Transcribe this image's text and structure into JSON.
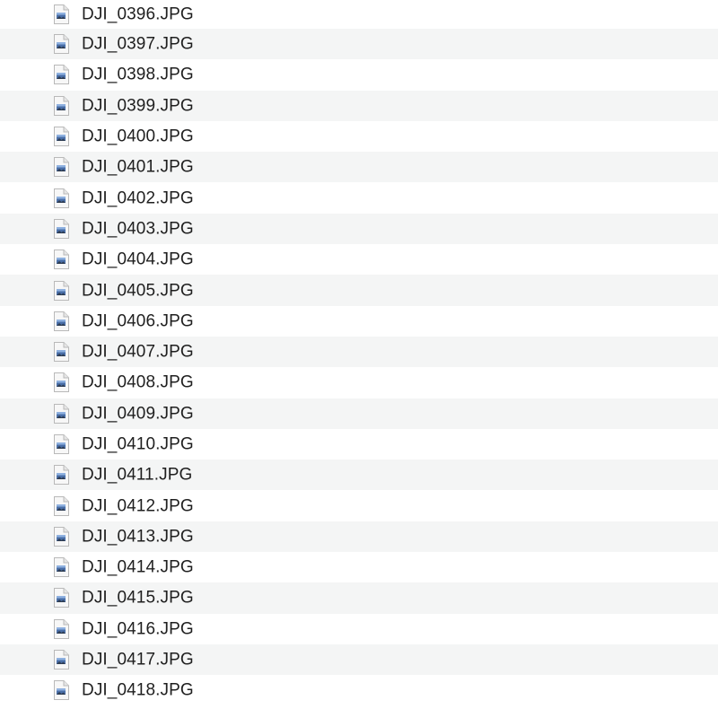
{
  "file_list": {
    "icon": "jpeg-image-file-icon",
    "files": [
      "DJI_0396.JPG",
      "DJI_0397.JPG",
      "DJI_0398.JPG",
      "DJI_0399.JPG",
      "DJI_0400.JPG",
      "DJI_0401.JPG",
      "DJI_0402.JPG",
      "DJI_0403.JPG",
      "DJI_0404.JPG",
      "DJI_0405.JPG",
      "DJI_0406.JPG",
      "DJI_0407.JPG",
      "DJI_0408.JPG",
      "DJI_0409.JPG",
      "DJI_0410.JPG",
      "DJI_0411.JPG",
      "DJI_0412.JPG",
      "DJI_0413.JPG",
      "DJI_0414.JPG",
      "DJI_0415.JPG",
      "DJI_0416.JPG",
      "DJI_0417.JPG",
      "DJI_0418.JPG"
    ]
  },
  "colors": {
    "row_alt": "#f4f5f5",
    "row_base": "#ffffff",
    "text": "#1f1f1f"
  }
}
